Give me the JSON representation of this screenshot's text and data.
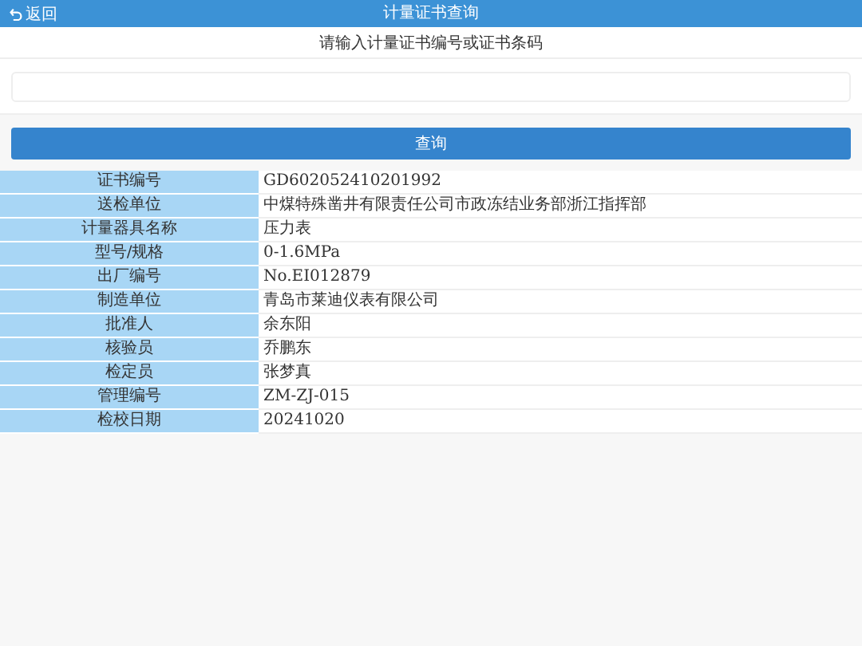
{
  "header": {
    "back_label": "返回",
    "title": "计量证书查询"
  },
  "prompt": "请输入计量证书编号或证书条码",
  "query_button": "查询",
  "details": [
    {
      "label": "证书编号",
      "value": "GD602052410201992"
    },
    {
      "label": "送检单位",
      "value": "中煤特殊凿井有限责任公司市政冻结业务部浙江指挥部"
    },
    {
      "label": "计量器具名称",
      "value": "压力表"
    },
    {
      "label": "型号/规格",
      "value": "0-1.6MPa"
    },
    {
      "label": "出厂编号",
      "value": "No.EI012879"
    },
    {
      "label": "制造单位",
      "value": "青岛市莱迪仪表有限公司"
    },
    {
      "label": "批准人",
      "value": "余东阳"
    },
    {
      "label": "核验员",
      "value": "乔鹏东"
    },
    {
      "label": "检定员",
      "value": "张梦真"
    },
    {
      "label": "管理编号",
      "value": "ZM-ZJ-015"
    },
    {
      "label": "检校日期",
      "value": "20241020"
    }
  ]
}
